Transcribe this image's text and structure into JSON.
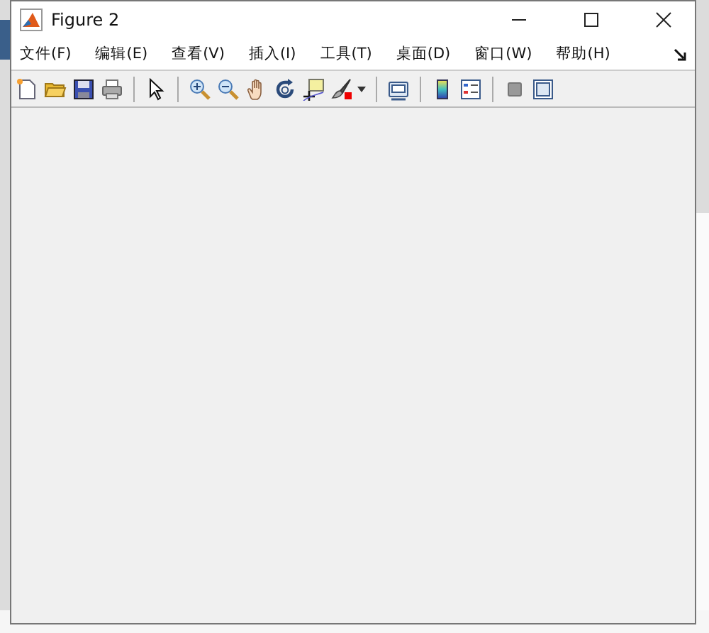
{
  "window": {
    "title": "Figure 2"
  },
  "menu": [
    {
      "label": "文件(F)"
    },
    {
      "label": "编辑(E)"
    },
    {
      "label": "查看(V)"
    },
    {
      "label": "插入(I)"
    },
    {
      "label": "工具(T)"
    },
    {
      "label": "桌面(D)"
    },
    {
      "label": "窗口(W)"
    },
    {
      "label": "帮助(H)"
    }
  ]
}
